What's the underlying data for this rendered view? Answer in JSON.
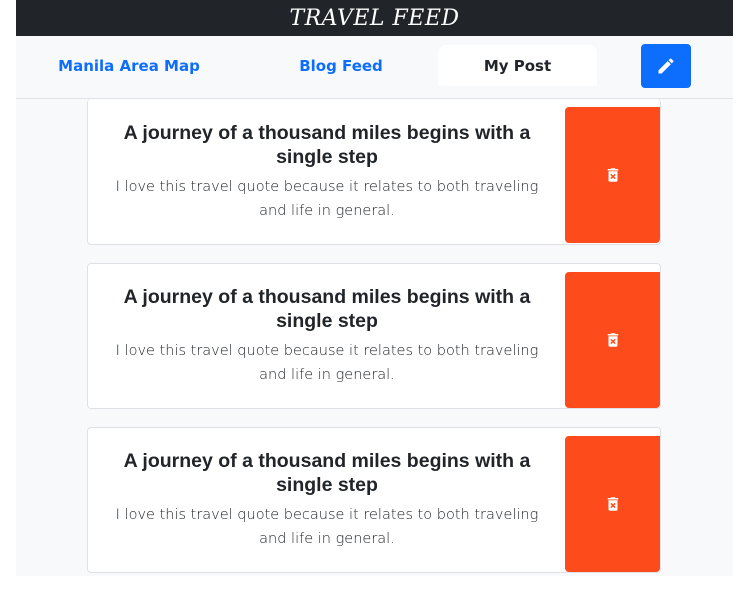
{
  "header": {
    "title": "TRAVEL FEED"
  },
  "nav": {
    "links": [
      {
        "label": "Manila Area Map"
      },
      {
        "label": "Blog Feed"
      },
      {
        "label": "My Post"
      }
    ],
    "edit_icon": "pencil-icon"
  },
  "posts": [
    {
      "title": "A journey of a thousand miles begins with a single step",
      "text": "I love this travel quote because it relates to both traveling and life in general.",
      "delete_icon": "trash-icon"
    },
    {
      "title": "A journey of a thousand miles begins with a single step",
      "text": "I love this travel quote because it relates to both traveling and life in general.",
      "delete_icon": "trash-icon"
    },
    {
      "title": "A journey of a thousand miles begins with a single step",
      "text": "I love this travel quote because it relates to both traveling and life in general.",
      "delete_icon": "trash-icon"
    }
  ],
  "colors": {
    "header_bg": "#212529",
    "link": "#0d6efd",
    "delete_bg": "#fd4b1c",
    "edit_bg": "#0d6efd"
  }
}
